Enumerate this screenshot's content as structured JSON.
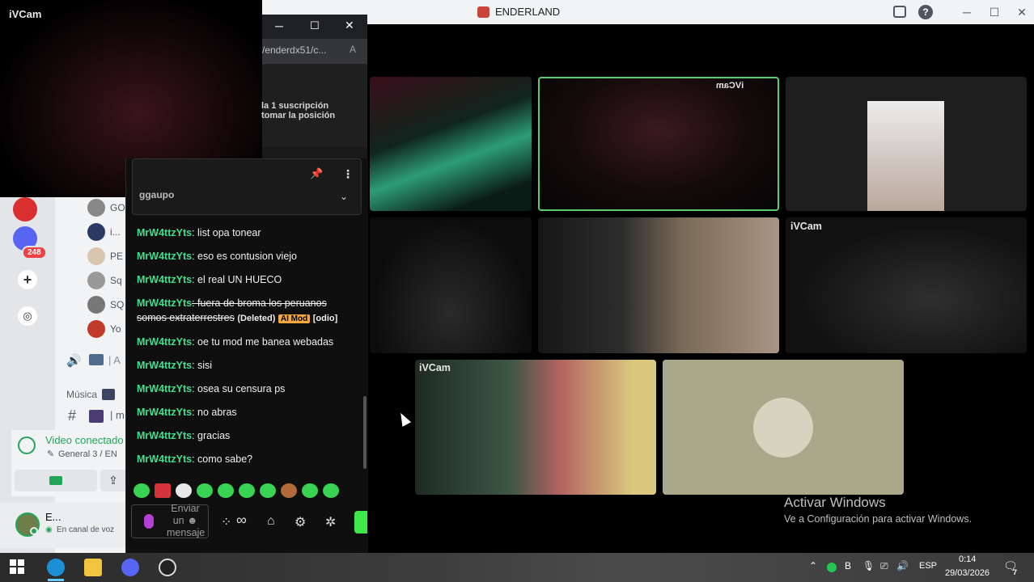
{
  "window": {
    "title": "ENDERLAND"
  },
  "preview": {
    "label": "iVCam"
  },
  "popup": {
    "url": "/enderdx51/c...",
    "notice_line1": "la 1 suscripción",
    "notice_line2": "tomar la posición"
  },
  "sidebar": {
    "badge_count": "248",
    "dm_items": [
      {
        "label": "GO"
      },
      {
        "label": "i..."
      },
      {
        "label": "PE"
      },
      {
        "label": "Sq"
      },
      {
        "label": "SQ"
      },
      {
        "label": "Yo"
      }
    ],
    "voice_channel_abbrev": "A",
    "music_label": "Música",
    "text_channel_abbrev": "m"
  },
  "chat": {
    "header_title": "ggaupo",
    "messages": [
      {
        "user": "MrW4ttzYts",
        "text": ": list opa tonear"
      },
      {
        "user": "MrW4ttzYts",
        "text": ": eso es contusion viejo"
      },
      {
        "user": "MrW4ttzYts",
        "text": ": el real UN HUECO"
      },
      {
        "user": "MrW4ttzYts",
        "text": ": fuera de broma los peruanos somos extraterrestres",
        "deleted": "(Deleted)",
        "badge": "AI Mod",
        "tag": "[odio]"
      },
      {
        "user": "MrW4ttzYts",
        "text": ": oe tu mod me banea webadas"
      },
      {
        "user": "MrW4ttzYts",
        "text": ": sisi"
      },
      {
        "user": "MrW4ttzYts",
        "text": ": osea su censura ps"
      },
      {
        "user": "MrW4ttzYts",
        "text": ": no abras"
      },
      {
        "user": "MrW4ttzYts",
        "text": ": gracias"
      },
      {
        "user": "MrW4ttzYts",
        "text": ": como sabe?"
      }
    ],
    "input_placeholder": "Enviar un ☻ mensaje",
    "infinity_label": "∞"
  },
  "video_grid": {
    "tile_labels": {
      "top_center_mirrored": "iVCam",
      "mid_right": "iVCam",
      "bottom_left": "iVCam"
    }
  },
  "voice": {
    "status": "Video conectado",
    "channel": "General 3 / EN",
    "user_name": "E...",
    "user_status": "En canal de voz"
  },
  "watermark": {
    "title": "Activar Windows",
    "subtitle": "Ve a Configuración para activar Windows."
  },
  "taskbar": {
    "language": "ESP",
    "time": "0:14",
    "date": "29/03/2026",
    "notification_count": "7"
  },
  "colors": {
    "username_green": "#3ee08f",
    "ai_mod_badge": "#f2a93b",
    "voice_green": "#23a559",
    "active_speaker_border": "#5dcc6f"
  }
}
